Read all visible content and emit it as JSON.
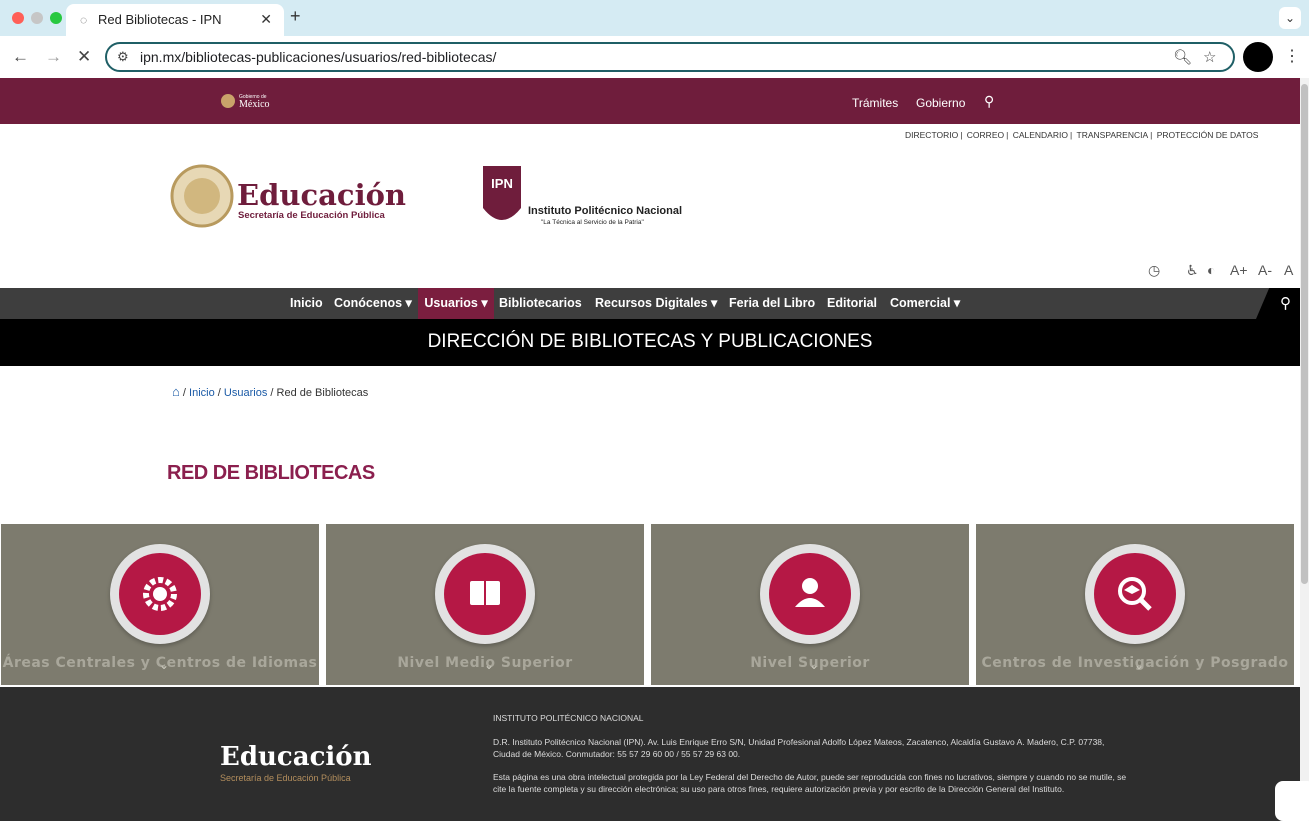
{
  "browser": {
    "tab_title": "Red Bibliotecas - IPN",
    "url": "ipn.mx/bibliotecas-publicaciones/usuarios/red-bibliotecas/"
  },
  "gov": {
    "logo_small": "Gobierno de",
    "logo_big": "México",
    "links": [
      "Trámites",
      "Gobierno"
    ]
  },
  "utility_links": [
    "DIRECTORIO",
    "CORREO",
    "CALENDARIO",
    "TRANSPARENCIA",
    "PROTECCIÓN DE DATOS"
  ],
  "header": {
    "sep_title": "Educación",
    "sep_subtitle": "Secretaría de Educación Pública",
    "ipn_title": "Instituto Politécnico Nacional",
    "ipn_motto": "\"La Técnica al Servicio de la Patria\"",
    "ipn_mark": "IPN"
  },
  "a11y": {
    "increase": "A+",
    "decrease": "A-",
    "reset": "A"
  },
  "nav": {
    "items": [
      {
        "label": "Inicio"
      },
      {
        "label": "Conócenos ▾"
      },
      {
        "label": "Usuarios ▾"
      },
      {
        "label": "Bibliotecarios"
      },
      {
        "label": "Recursos Digitales ▾"
      },
      {
        "label": "Feria del Libro"
      },
      {
        "label": "Editorial"
      },
      {
        "label": "Comercial ▾"
      }
    ]
  },
  "band_title": "DIRECCIÓN DE BIBLIOTECAS Y PUBLICACIONES",
  "breadcrumb": {
    "items": [
      "Inicio",
      "Usuarios",
      "Red de Bibliotecas"
    ],
    "sep": "/"
  },
  "page_title": "RED DE BIBLIOTECAS",
  "cards": [
    {
      "label": "Áreas Centrales y Centros de Idiomas",
      "icon": "gear-icon"
    },
    {
      "label": "Nivel Medio Superior",
      "icon": "book-icon"
    },
    {
      "label": "Nivel Superior",
      "icon": "user-icon"
    },
    {
      "label": "Centros de Investigación y Posgrado",
      "icon": "search-cap-icon"
    }
  ],
  "footer": {
    "edu_title": "Educación",
    "edu_subtitle": "Secretaría de Educación Pública",
    "inst": "INSTITUTO POLITÉCNICO NACIONAL",
    "address": "D.R. Instituto Politécnico Nacional (IPN). Av. Luis Enrique Erro S/N, Unidad Profesional Adolfo López Mateos, Zacatenco, Alcaldía Gustavo A. Madero, C.P. 07738, Ciudad de México. Conmutador: 55 57 29 60 00 / 55 57 29 63 00.",
    "copyright": "Esta página es una obra intelectual protegida por la Ley Federal del Derecho de Autor, puede ser reproducida con fines no lucrativos, siempre y cuando no se mutile, se cite la fuente completa y su dirección electrónica; su uso para otros fines, requiere autorización previa y por escrito de la Dirección General del Instituto."
  },
  "colors": {
    "gov": "#6f1d3c",
    "accent": "#8b1f4e",
    "card": "#7d7b6e",
    "icon": "#b51845",
    "nav": "#3e3e3e"
  }
}
